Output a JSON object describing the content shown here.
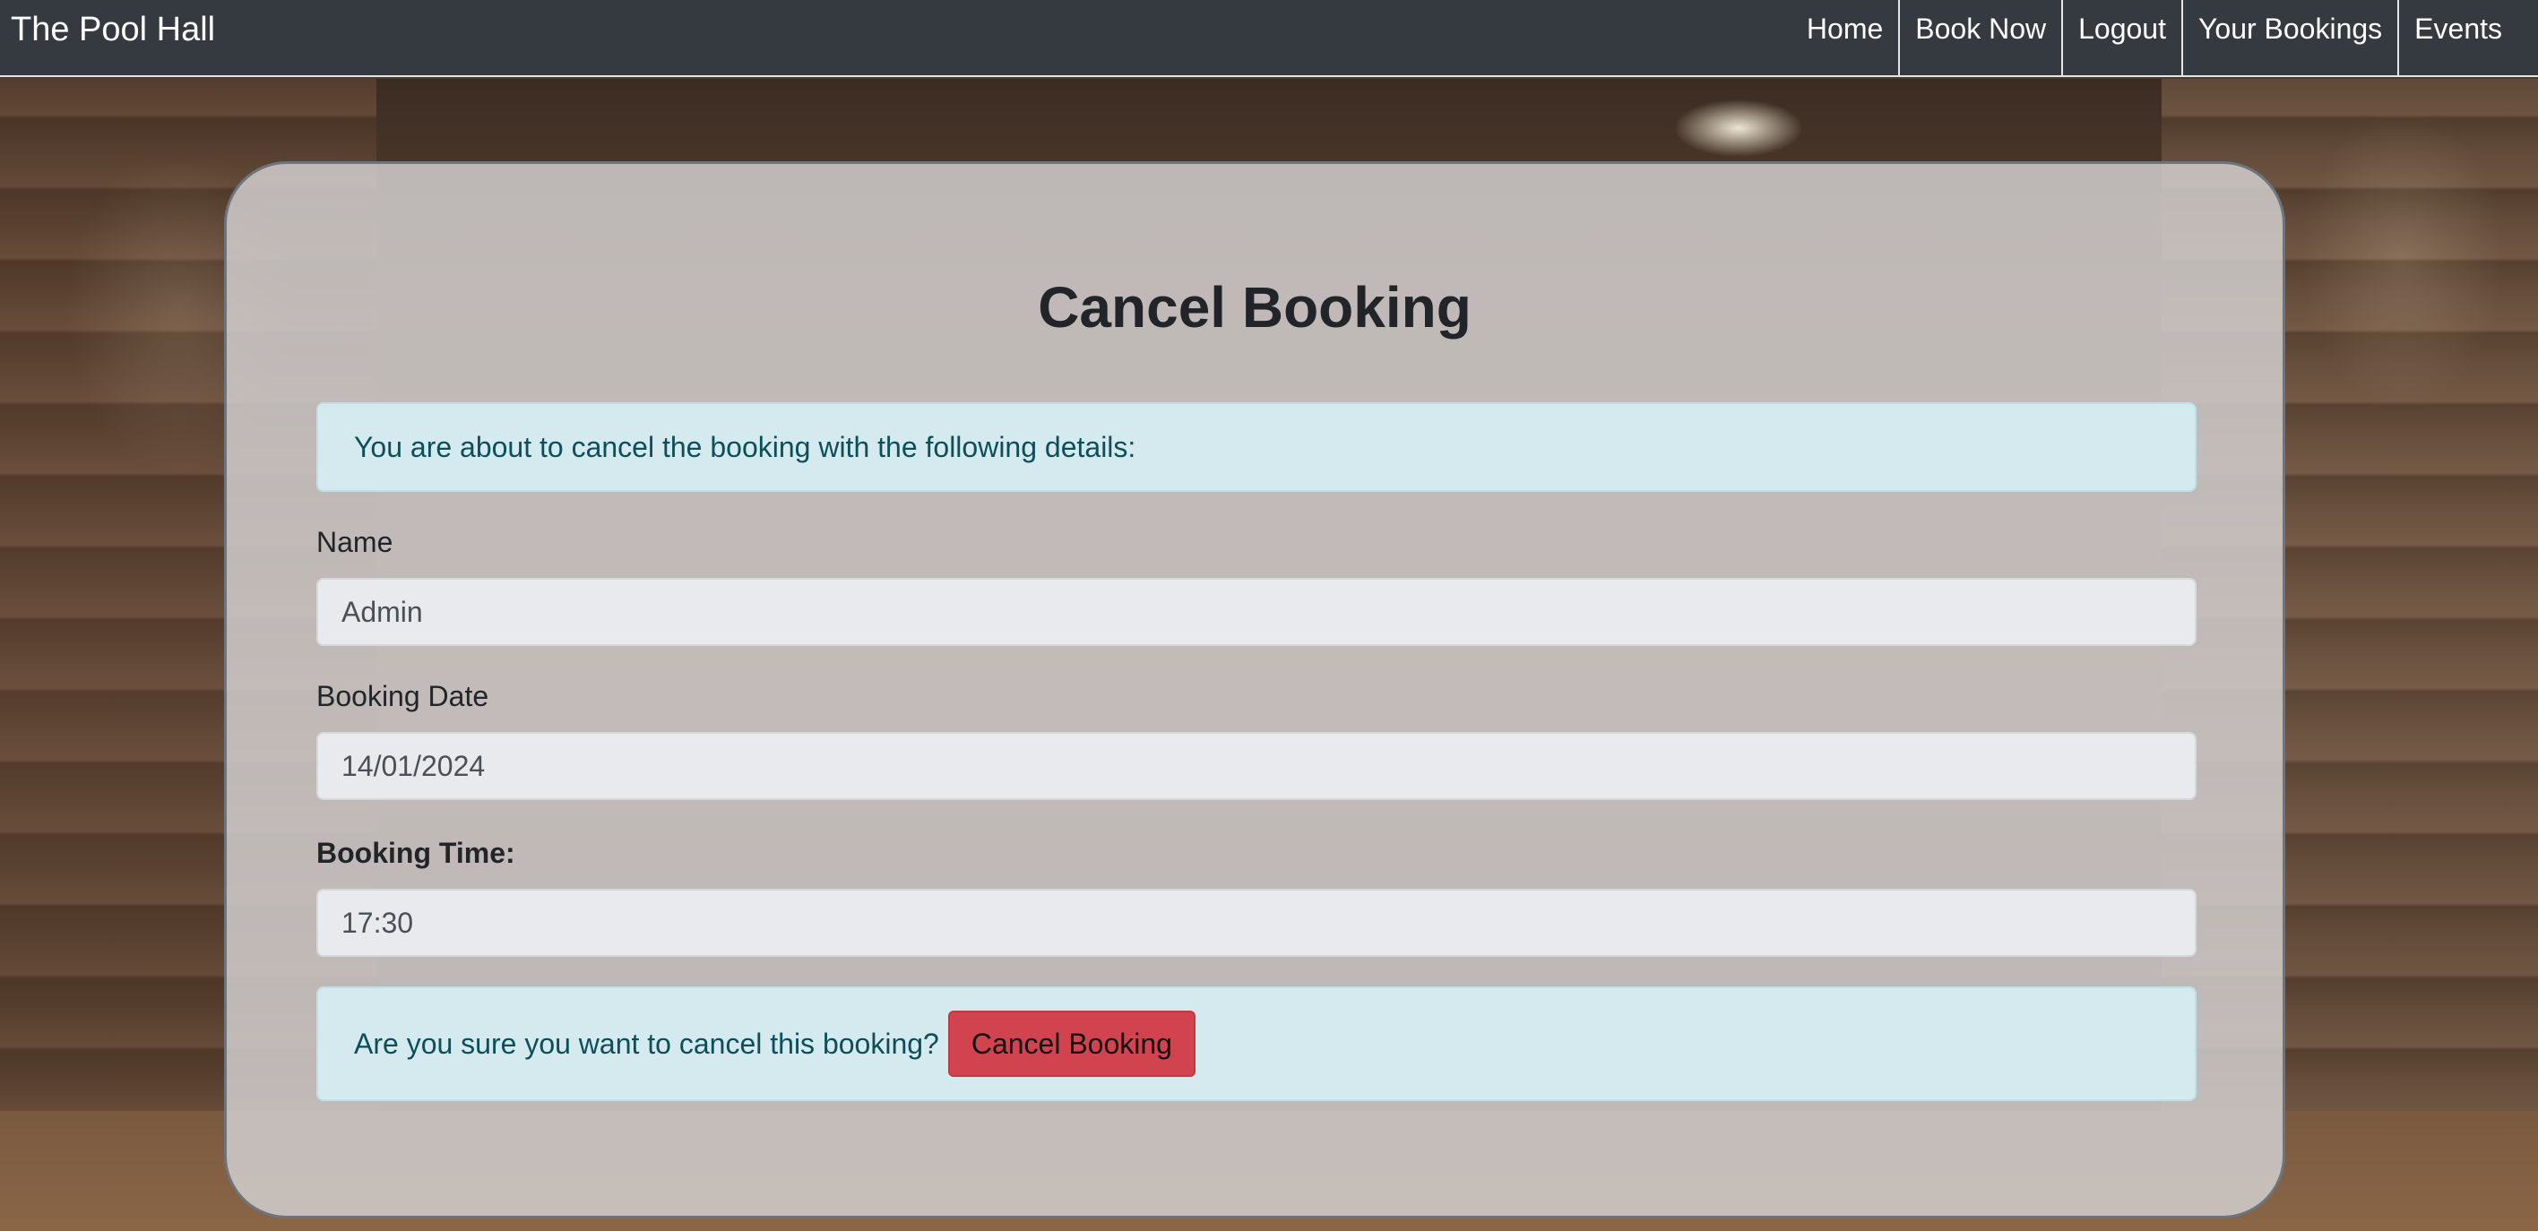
{
  "navbar": {
    "brand": "The Pool Hall",
    "links": [
      "Home",
      "Book Now",
      "Logout",
      "Your Bookings",
      "Events"
    ]
  },
  "page": {
    "title": "Cancel Booking",
    "intro_alert": "You are about to cancel the booking with the following details:",
    "name_label": "Name",
    "name_value": "Admin",
    "date_label": "Booking Date",
    "date_value": "14/01/2024",
    "time_label": "Booking Time:",
    "time_value": "17:30",
    "confirm_text": "Are you sure you want to cancel this booking?",
    "cancel_button": "Cancel Booking"
  },
  "colors": {
    "navbar_bg": "#343a40",
    "alert_bg": "#d4eaef",
    "danger": "#d0434f"
  }
}
